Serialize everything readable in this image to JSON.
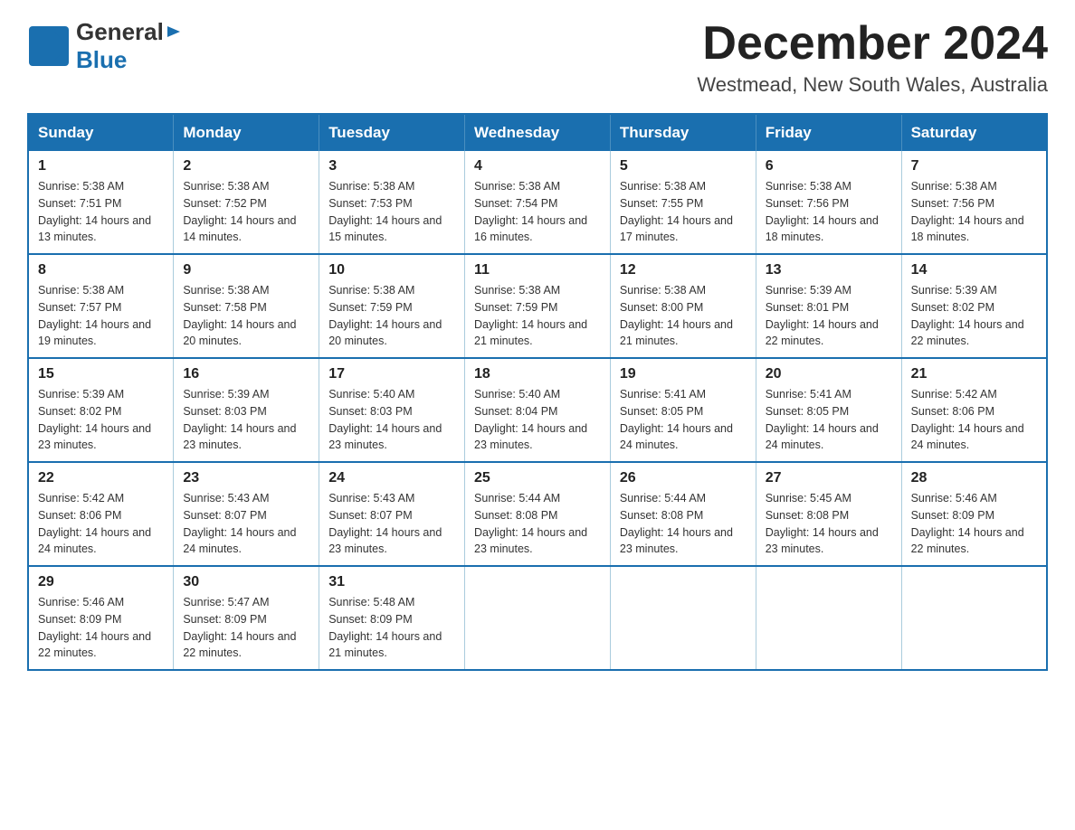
{
  "header": {
    "logo_general": "General",
    "logo_blue": "Blue",
    "month_title": "December 2024",
    "location": "Westmead, New South Wales, Australia"
  },
  "weekdays": [
    "Sunday",
    "Monday",
    "Tuesday",
    "Wednesday",
    "Thursday",
    "Friday",
    "Saturday"
  ],
  "weeks": [
    [
      {
        "day": "1",
        "sunrise": "Sunrise: 5:38 AM",
        "sunset": "Sunset: 7:51 PM",
        "daylight": "Daylight: 14 hours and 13 minutes."
      },
      {
        "day": "2",
        "sunrise": "Sunrise: 5:38 AM",
        "sunset": "Sunset: 7:52 PM",
        "daylight": "Daylight: 14 hours and 14 minutes."
      },
      {
        "day": "3",
        "sunrise": "Sunrise: 5:38 AM",
        "sunset": "Sunset: 7:53 PM",
        "daylight": "Daylight: 14 hours and 15 minutes."
      },
      {
        "day": "4",
        "sunrise": "Sunrise: 5:38 AM",
        "sunset": "Sunset: 7:54 PM",
        "daylight": "Daylight: 14 hours and 16 minutes."
      },
      {
        "day": "5",
        "sunrise": "Sunrise: 5:38 AM",
        "sunset": "Sunset: 7:55 PM",
        "daylight": "Daylight: 14 hours and 17 minutes."
      },
      {
        "day": "6",
        "sunrise": "Sunrise: 5:38 AM",
        "sunset": "Sunset: 7:56 PM",
        "daylight": "Daylight: 14 hours and 18 minutes."
      },
      {
        "day": "7",
        "sunrise": "Sunrise: 5:38 AM",
        "sunset": "Sunset: 7:56 PM",
        "daylight": "Daylight: 14 hours and 18 minutes."
      }
    ],
    [
      {
        "day": "8",
        "sunrise": "Sunrise: 5:38 AM",
        "sunset": "Sunset: 7:57 PM",
        "daylight": "Daylight: 14 hours and 19 minutes."
      },
      {
        "day": "9",
        "sunrise": "Sunrise: 5:38 AM",
        "sunset": "Sunset: 7:58 PM",
        "daylight": "Daylight: 14 hours and 20 minutes."
      },
      {
        "day": "10",
        "sunrise": "Sunrise: 5:38 AM",
        "sunset": "Sunset: 7:59 PM",
        "daylight": "Daylight: 14 hours and 20 minutes."
      },
      {
        "day": "11",
        "sunrise": "Sunrise: 5:38 AM",
        "sunset": "Sunset: 7:59 PM",
        "daylight": "Daylight: 14 hours and 21 minutes."
      },
      {
        "day": "12",
        "sunrise": "Sunrise: 5:38 AM",
        "sunset": "Sunset: 8:00 PM",
        "daylight": "Daylight: 14 hours and 21 minutes."
      },
      {
        "day": "13",
        "sunrise": "Sunrise: 5:39 AM",
        "sunset": "Sunset: 8:01 PM",
        "daylight": "Daylight: 14 hours and 22 minutes."
      },
      {
        "day": "14",
        "sunrise": "Sunrise: 5:39 AM",
        "sunset": "Sunset: 8:02 PM",
        "daylight": "Daylight: 14 hours and 22 minutes."
      }
    ],
    [
      {
        "day": "15",
        "sunrise": "Sunrise: 5:39 AM",
        "sunset": "Sunset: 8:02 PM",
        "daylight": "Daylight: 14 hours and 23 minutes."
      },
      {
        "day": "16",
        "sunrise": "Sunrise: 5:39 AM",
        "sunset": "Sunset: 8:03 PM",
        "daylight": "Daylight: 14 hours and 23 minutes."
      },
      {
        "day": "17",
        "sunrise": "Sunrise: 5:40 AM",
        "sunset": "Sunset: 8:03 PM",
        "daylight": "Daylight: 14 hours and 23 minutes."
      },
      {
        "day": "18",
        "sunrise": "Sunrise: 5:40 AM",
        "sunset": "Sunset: 8:04 PM",
        "daylight": "Daylight: 14 hours and 23 minutes."
      },
      {
        "day": "19",
        "sunrise": "Sunrise: 5:41 AM",
        "sunset": "Sunset: 8:05 PM",
        "daylight": "Daylight: 14 hours and 24 minutes."
      },
      {
        "day": "20",
        "sunrise": "Sunrise: 5:41 AM",
        "sunset": "Sunset: 8:05 PM",
        "daylight": "Daylight: 14 hours and 24 minutes."
      },
      {
        "day": "21",
        "sunrise": "Sunrise: 5:42 AM",
        "sunset": "Sunset: 8:06 PM",
        "daylight": "Daylight: 14 hours and 24 minutes."
      }
    ],
    [
      {
        "day": "22",
        "sunrise": "Sunrise: 5:42 AM",
        "sunset": "Sunset: 8:06 PM",
        "daylight": "Daylight: 14 hours and 24 minutes."
      },
      {
        "day": "23",
        "sunrise": "Sunrise: 5:43 AM",
        "sunset": "Sunset: 8:07 PM",
        "daylight": "Daylight: 14 hours and 24 minutes."
      },
      {
        "day": "24",
        "sunrise": "Sunrise: 5:43 AM",
        "sunset": "Sunset: 8:07 PM",
        "daylight": "Daylight: 14 hours and 23 minutes."
      },
      {
        "day": "25",
        "sunrise": "Sunrise: 5:44 AM",
        "sunset": "Sunset: 8:08 PM",
        "daylight": "Daylight: 14 hours and 23 minutes."
      },
      {
        "day": "26",
        "sunrise": "Sunrise: 5:44 AM",
        "sunset": "Sunset: 8:08 PM",
        "daylight": "Daylight: 14 hours and 23 minutes."
      },
      {
        "day": "27",
        "sunrise": "Sunrise: 5:45 AM",
        "sunset": "Sunset: 8:08 PM",
        "daylight": "Daylight: 14 hours and 23 minutes."
      },
      {
        "day": "28",
        "sunrise": "Sunrise: 5:46 AM",
        "sunset": "Sunset: 8:09 PM",
        "daylight": "Daylight: 14 hours and 22 minutes."
      }
    ],
    [
      {
        "day": "29",
        "sunrise": "Sunrise: 5:46 AM",
        "sunset": "Sunset: 8:09 PM",
        "daylight": "Daylight: 14 hours and 22 minutes."
      },
      {
        "day": "30",
        "sunrise": "Sunrise: 5:47 AM",
        "sunset": "Sunset: 8:09 PM",
        "daylight": "Daylight: 14 hours and 22 minutes."
      },
      {
        "day": "31",
        "sunrise": "Sunrise: 5:48 AM",
        "sunset": "Sunset: 8:09 PM",
        "daylight": "Daylight: 14 hours and 21 minutes."
      },
      null,
      null,
      null,
      null
    ]
  ]
}
